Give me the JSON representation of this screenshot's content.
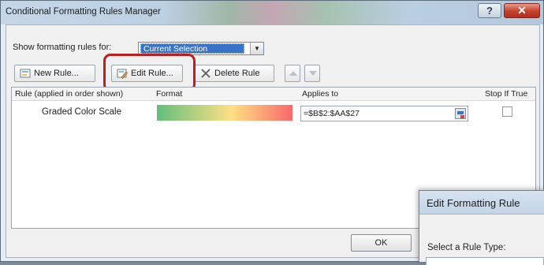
{
  "window": {
    "title": "Conditional Formatting Rules Manager",
    "help_glyph": "?",
    "close_glyph": "✕"
  },
  "filter": {
    "label": "Show formatting rules for:",
    "selected": "Current Selection"
  },
  "toolbar": {
    "new_rule": "New Rule...",
    "edit_rule": "Edit Rule...",
    "delete_rule": "Delete Rule"
  },
  "table": {
    "headers": {
      "rule": "Rule (applied in order shown)",
      "format": "Format",
      "applies_to": "Applies to",
      "stop_if_true": "Stop If True"
    },
    "rows": [
      {
        "rule": "Graded Color Scale",
        "format_colors": [
          "#63be7b",
          "#ffe084",
          "#f8696b"
        ],
        "applies_to": "=$B$2:$AA$27",
        "stop_if_true": false
      }
    ]
  },
  "buttons": {
    "ok": "OK"
  },
  "edit_dialog": {
    "title": "Edit Formatting Rule",
    "select_label": "Select a Rule Type:"
  },
  "colors": {
    "highlight": "#c01d1d",
    "selection": "#3873c8"
  }
}
